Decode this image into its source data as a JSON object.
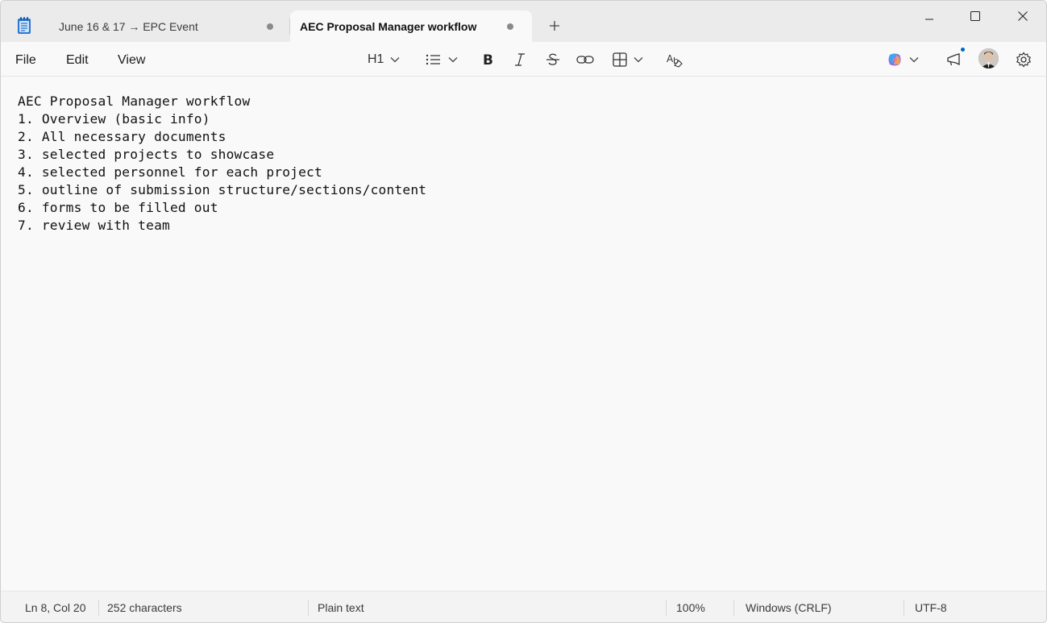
{
  "tabs": [
    {
      "label": "June 16 & 17 → EPC Event",
      "unsaved": true
    },
    {
      "label": "AEC Proposal Manager workflow",
      "unsaved": true,
      "active": true
    }
  ],
  "menu": {
    "file": "File",
    "edit": "Edit",
    "view": "View"
  },
  "toolbar": {
    "heading_label": "H1",
    "icons": [
      "heading-dropdown",
      "list-icon",
      "bold-icon",
      "italic-icon",
      "strikethrough-icon",
      "link-icon",
      "table-icon",
      "clear-formatting-icon",
      "copilot-icon",
      "whats-new-icon",
      "settings-icon"
    ]
  },
  "document": {
    "lines": [
      "AEC Proposal Manager workflow",
      "1. Overview (basic info)",
      "2. All necessary documents",
      "3. selected projects to showcase",
      "4. selected personnel for each project",
      "5. outline of submission structure/sections/content",
      "6. forms to be filled out",
      "7. review with team"
    ]
  },
  "status": {
    "position": "Ln 8, Col 20",
    "characters": "252 characters",
    "format": "Plain text",
    "zoom": "100%",
    "line_ending": "Windows (CRLF)",
    "encoding": "UTF-8"
  },
  "colors": {
    "accent": "#0067c0",
    "titlebar": "#ebebeb",
    "editor_bg": "#f9f9f9"
  }
}
